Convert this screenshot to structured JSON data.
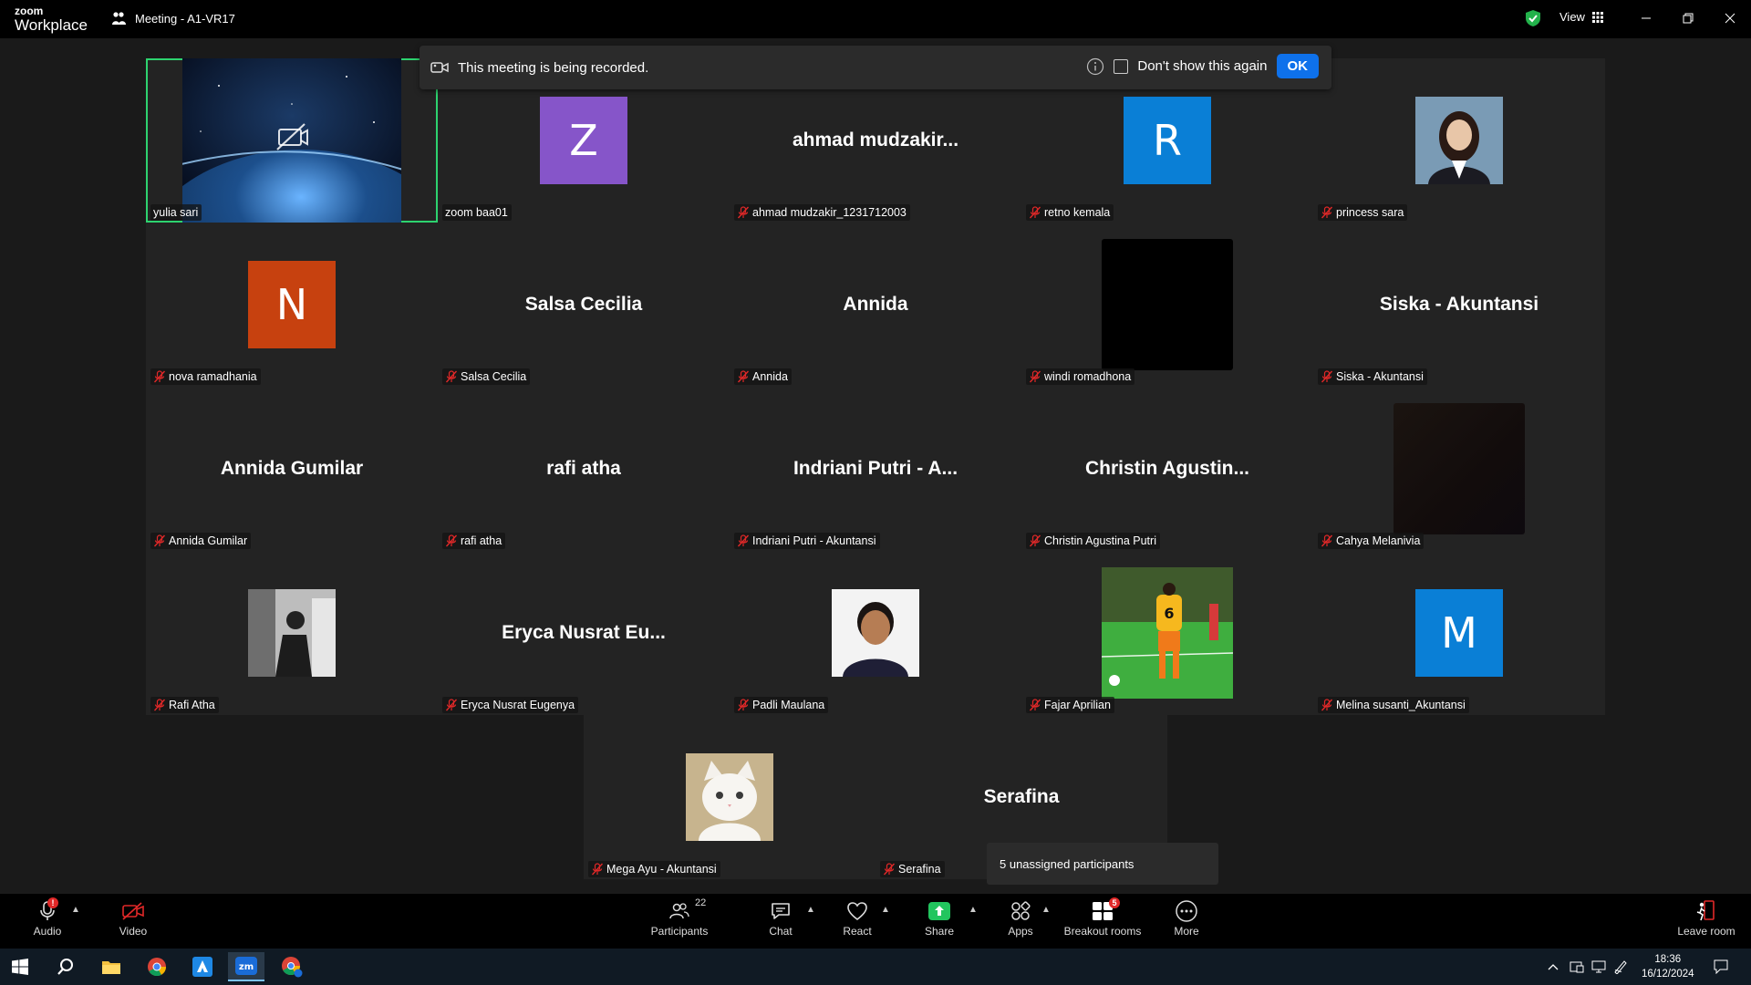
{
  "window": {
    "brand_top": "zoom",
    "brand_bottom": "Workplace",
    "meeting_title": "Meeting - A1-VR17",
    "view_label": "View"
  },
  "recording_banner": {
    "text": "This meeting is being recorded.",
    "dont_show": "Don't show this again",
    "ok": "OK"
  },
  "tiles": [
    {
      "tag": "yulia sari",
      "type": "image",
      "icon": "earth-video-off",
      "active": true,
      "muted": false
    },
    {
      "tag": "zoom baa01",
      "type": "letter",
      "letter": "Z",
      "color": "#8655c9",
      "muted": false
    },
    {
      "tag": "ahmad mudzakir_1231712003",
      "type": "bigname",
      "big": "ahmad  mudzakir...",
      "muted": true
    },
    {
      "tag": "retno kemala",
      "type": "letter",
      "letter": "R",
      "color": "#0a7fd6",
      "muted": true
    },
    {
      "tag": "princess sara",
      "type": "photo",
      "icon": "portrait-woman-photo",
      "muted": true
    },
    {
      "tag": "nova ramadhania",
      "type": "letter",
      "letter": "N",
      "color": "#c7410f",
      "muted": true
    },
    {
      "tag": "Salsa Cecilia",
      "type": "bigname",
      "big": "Salsa Cecilia",
      "muted": true
    },
    {
      "tag": "Annida",
      "type": "bigname",
      "big": "Annida",
      "muted": true
    },
    {
      "tag": "windi romadhona",
      "type": "blackbox",
      "muted": true
    },
    {
      "tag": "Siska - Akuntansi",
      "type": "bigname",
      "big": "Siska - Akuntansi",
      "muted": true
    },
    {
      "tag": "Annida Gumilar",
      "type": "bigname",
      "big": "Annida Gumilar",
      "muted": true
    },
    {
      "tag": "rafi atha",
      "type": "bigname",
      "big": "rafi atha",
      "muted": true
    },
    {
      "tag": "Indriani Putri - Akuntansi",
      "type": "bigname",
      "big": "Indriani Putri - A...",
      "muted": true
    },
    {
      "tag": "Christin Agustina Putri",
      "type": "bigname",
      "big": "Christin  Agustin...",
      "muted": true
    },
    {
      "tag": "Cahya Melanivia",
      "type": "darkbox",
      "muted": true
    },
    {
      "tag": "Rafi Atha",
      "type": "photo",
      "icon": "bw-person-photo",
      "muted": true
    },
    {
      "tag": "Eryca Nusrat Eugenya",
      "type": "bigname",
      "big": "Eryca Nusrat Eu...",
      "muted": true
    },
    {
      "tag": "Padli Maulana",
      "type": "photo",
      "icon": "portrait-man-photo",
      "muted": true
    },
    {
      "tag": "Fajar Aprilian",
      "type": "soccer",
      "icon": "soccer-player-photo",
      "muted": true
    },
    {
      "tag": "Melina susanti_Akuntansi",
      "type": "letter",
      "letter": "M",
      "color": "#0a7fd6",
      "muted": true
    },
    {
      "tag": "Mega Ayu - Akuntansi",
      "type": "photo",
      "icon": "white-cat-photo",
      "muted": true
    },
    {
      "tag": "Serafina",
      "type": "bigname",
      "big": "Serafina",
      "muted": true
    }
  ],
  "unassigned": "5 unassigned participants",
  "toolbar": {
    "audio": "Audio",
    "video": "Video",
    "participants": "Participants",
    "participants_count": "22",
    "chat": "Chat",
    "react": "React",
    "share": "Share",
    "apps": "Apps",
    "breakout": "Breakout rooms",
    "breakout_badge": "5",
    "more": "More",
    "leave": "Leave room"
  },
  "taskbar": {
    "time": "18:36",
    "date": "16/12/2024"
  },
  "colors": {
    "active_border": "#2dd36f",
    "ok_button": "#0e71eb",
    "share_green": "#22c55e",
    "muted_red": "#e02828"
  }
}
